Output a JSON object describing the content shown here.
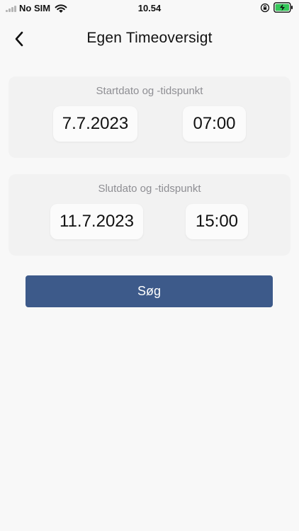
{
  "status_bar": {
    "carrier": "No SIM",
    "time": "10.54",
    "icons": [
      "signal-icon",
      "wifi-icon",
      "rotation-lock-icon",
      "battery-charging-icon"
    ]
  },
  "nav": {
    "title": "Egen Timeoversigt",
    "back_icon": "chevron-left-icon"
  },
  "start": {
    "label": "Startdato og -tidspunkt",
    "date": "7.7.2023",
    "time": "07:00"
  },
  "end": {
    "label": "Slutdato og -tidspunkt",
    "date": "11.7.2023",
    "time": "15:00"
  },
  "search_button": {
    "label": "Søg"
  },
  "colors": {
    "background": "#f8f8f8",
    "card": "#f2f2f2",
    "button": "#3d5a8a",
    "battery_green": "#34c759"
  }
}
